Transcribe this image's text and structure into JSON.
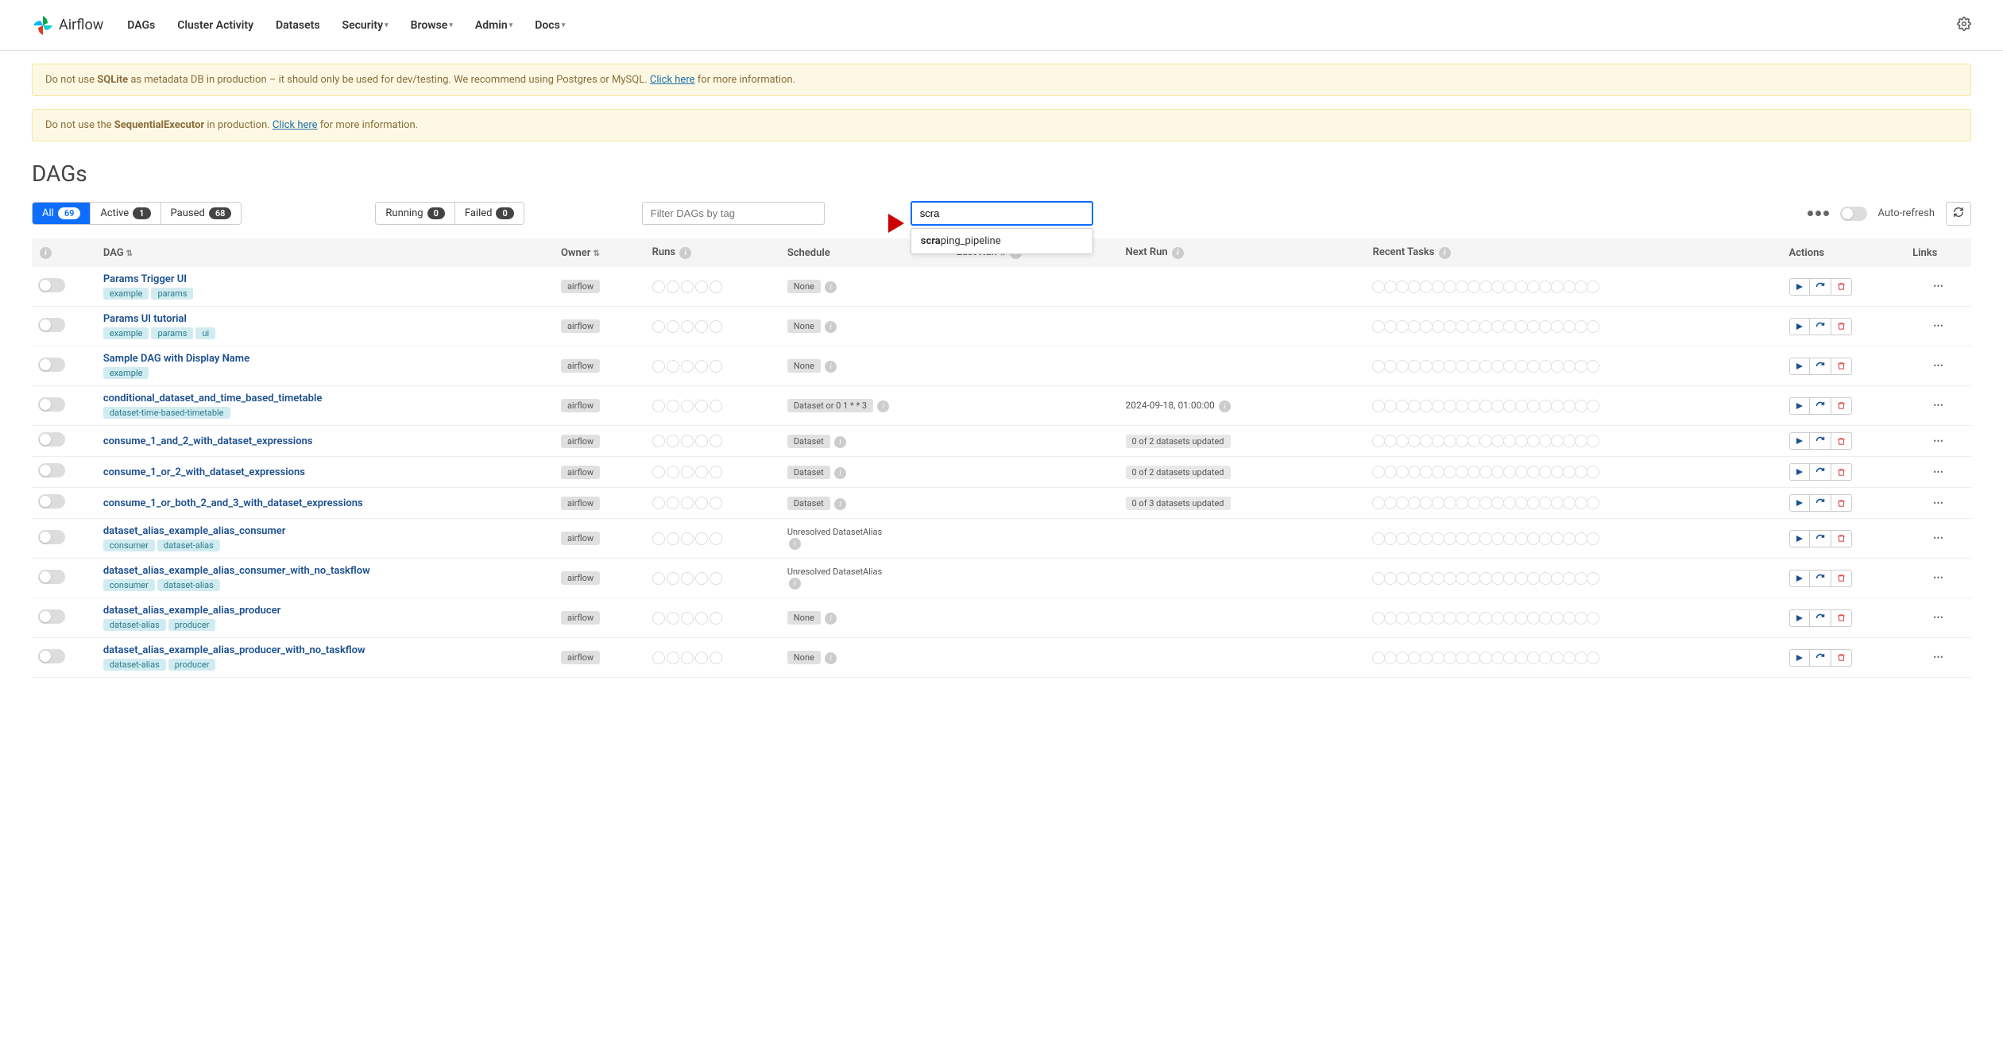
{
  "brand": "Airflow",
  "nav": [
    "DAGs",
    "Cluster Activity",
    "Datasets",
    "Security",
    "Browse",
    "Admin",
    "Docs"
  ],
  "nav_has_caret": [
    false,
    false,
    false,
    true,
    true,
    true,
    true
  ],
  "alerts": [
    {
      "pre": "Do not use ",
      "bold": "SQLite",
      "mid": " as metadata DB in production – it should only be used for dev/testing. We recommend using Postgres or MySQL. ",
      "link": "Click here",
      "post": " for more information."
    },
    {
      "pre": "Do not use the ",
      "bold": "SequentialExecutor",
      "mid": " in production. ",
      "link": "Click here",
      "post": " for more information."
    }
  ],
  "page_title": "DAGs",
  "filters": {
    "all": {
      "label": "All",
      "count": "69"
    },
    "active": {
      "label": "Active",
      "count": "1"
    },
    "paused": {
      "label": "Paused",
      "count": "68"
    },
    "running": {
      "label": "Running",
      "count": "0"
    },
    "failed": {
      "label": "Failed",
      "count": "0"
    }
  },
  "tag_placeholder": "Filter DAGs by tag",
  "search_value": "scra",
  "autocomplete": {
    "prefix": "scra",
    "rest": "ping_pipeline"
  },
  "autorefresh_label": "Auto-refresh",
  "columns": {
    "dag": "DAG",
    "owner": "Owner",
    "runs": "Runs",
    "schedule": "Schedule",
    "last_run": "Last Run",
    "next_run": "Next Run",
    "tasks": "Recent Tasks",
    "actions": "Actions",
    "links": "Links"
  },
  "rows": [
    {
      "name": "Params Trigger UI",
      "tags": [
        "example",
        "params"
      ],
      "owner": "airflow",
      "schedule": "None",
      "schedule_info": true,
      "next_run": "",
      "task_count": 19
    },
    {
      "name": "Params UI tutorial",
      "tags": [
        "example",
        "params",
        "ui"
      ],
      "owner": "airflow",
      "schedule": "None",
      "schedule_info": true,
      "next_run": "",
      "task_count": 19
    },
    {
      "name": "Sample DAG with Display Name",
      "tags": [
        "example"
      ],
      "owner": "airflow",
      "schedule": "None",
      "schedule_info": true,
      "next_run": "",
      "task_count": 19
    },
    {
      "name": "conditional_dataset_and_time_based_timetable",
      "tags": [
        "dataset-time-based-timetable"
      ],
      "owner": "airflow",
      "schedule": "Dataset or 0 1 * * 3",
      "schedule_info": true,
      "next_run": "2024-09-18, 01:00:00",
      "next_run_info": true,
      "task_count": 19
    },
    {
      "name": "consume_1_and_2_with_dataset_expressions",
      "tags": [],
      "owner": "airflow",
      "schedule": "Dataset",
      "schedule_info": true,
      "next_run": "",
      "dataset_status": "0 of 2 datasets updated",
      "task_count": 19
    },
    {
      "name": "consume_1_or_2_with_dataset_expressions",
      "tags": [],
      "owner": "airflow",
      "schedule": "Dataset",
      "schedule_info": true,
      "next_run": "",
      "dataset_status": "0 of 2 datasets updated",
      "task_count": 19
    },
    {
      "name": "consume_1_or_both_2_and_3_with_dataset_expressions",
      "tags": [],
      "owner": "airflow",
      "schedule": "Dataset",
      "schedule_info": true,
      "next_run": "",
      "dataset_status": "0 of 3 datasets updated",
      "task_count": 19
    },
    {
      "name": "dataset_alias_example_alias_consumer",
      "tags": [
        "consumer",
        "dataset-alias"
      ],
      "owner": "airflow",
      "schedule": "Unresolved DatasetAlias",
      "schedule_info": true,
      "schedule_multiline": true,
      "next_run": "",
      "task_count": 19
    },
    {
      "name": "dataset_alias_example_alias_consumer_with_no_taskflow",
      "tags": [
        "consumer",
        "dataset-alias"
      ],
      "owner": "airflow",
      "schedule": "Unresolved DatasetAlias",
      "schedule_info": true,
      "schedule_multiline": true,
      "next_run": "",
      "task_count": 19
    },
    {
      "name": "dataset_alias_example_alias_producer",
      "tags": [
        "dataset-alias",
        "producer"
      ],
      "owner": "airflow",
      "schedule": "None",
      "schedule_info": true,
      "next_run": "",
      "task_count": 19
    },
    {
      "name": "dataset_alias_example_alias_producer_with_no_taskflow",
      "tags": [
        "dataset-alias",
        "producer"
      ],
      "owner": "airflow",
      "schedule": "None",
      "schedule_info": true,
      "next_run": "",
      "task_count": 19
    }
  ]
}
